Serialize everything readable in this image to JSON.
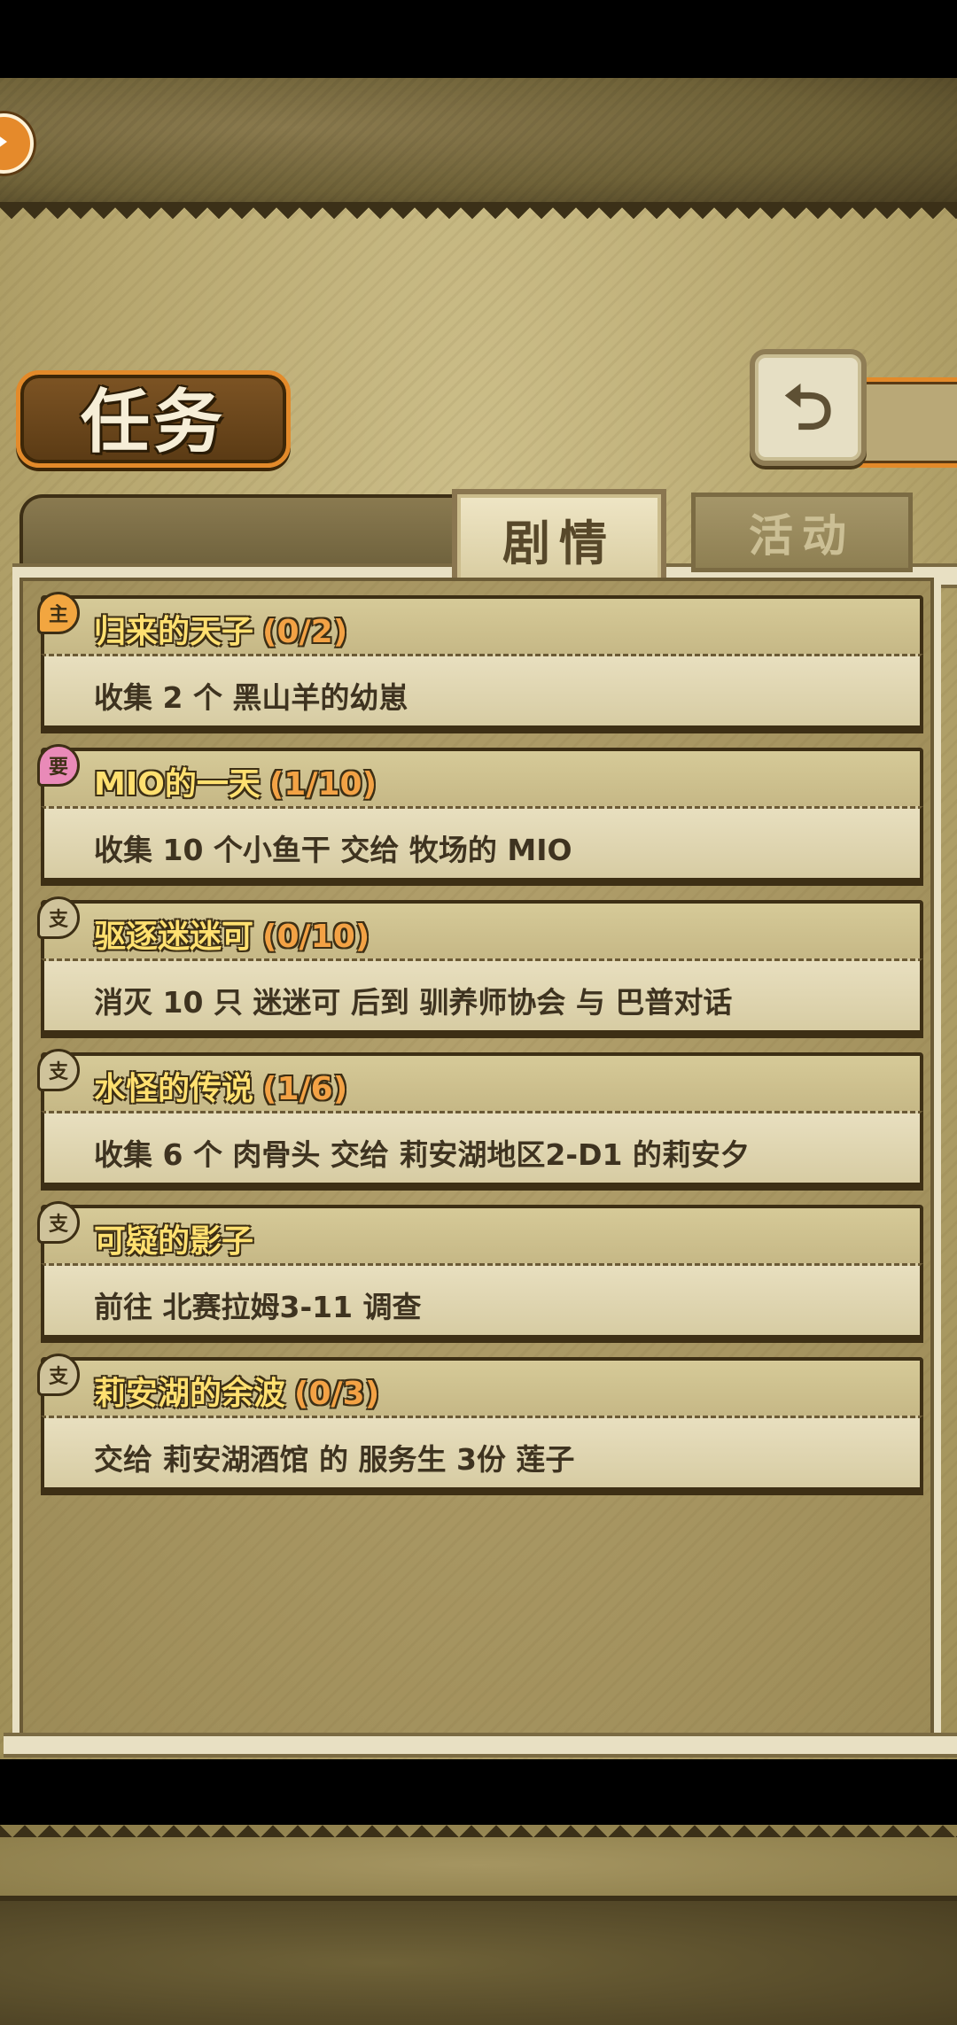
{
  "header": {
    "title": "任务",
    "return_icon": "return-arrow-icon"
  },
  "tabs": [
    {
      "label": "剧情",
      "active": true
    },
    {
      "label": "活动",
      "active": false
    }
  ],
  "quests": [
    {
      "badge": "主",
      "badge_color": "#f2a640",
      "title": "归来的天子",
      "progress": "(0/2)",
      "description": "收集 2 个 黑山羊的幼崽"
    },
    {
      "badge": "要",
      "badge_color": "#e98ab8",
      "title": "MIO的一天",
      "progress": "(1/10)",
      "description": "收集 10 个小鱼干 交给 牧场的 MIO"
    },
    {
      "badge": "支",
      "badge_color": "#cfc39b",
      "title": "驱逐迷迷可",
      "progress": "(0/10)",
      "description": "消灭 10 只 迷迷可 后到 驯养师协会 与 巴普对话"
    },
    {
      "badge": "支",
      "badge_color": "#cfc39b",
      "title": "水怪的传说",
      "progress": "(1/6)",
      "description": "收集 6 个 肉骨头 交给 莉安湖地区2-D1 的莉安夕"
    },
    {
      "badge": "支",
      "badge_color": "#cfc39b",
      "title": "可疑的影子",
      "progress": "",
      "description": "前往 北赛拉姆3-11 调查"
    },
    {
      "badge": "支",
      "badge_color": "#cfc39b",
      "title": "莉安湖的余波",
      "progress": "(0/3)",
      "description": "交给 莉安湖酒馆 的 服务生 3份 莲子"
    }
  ]
}
